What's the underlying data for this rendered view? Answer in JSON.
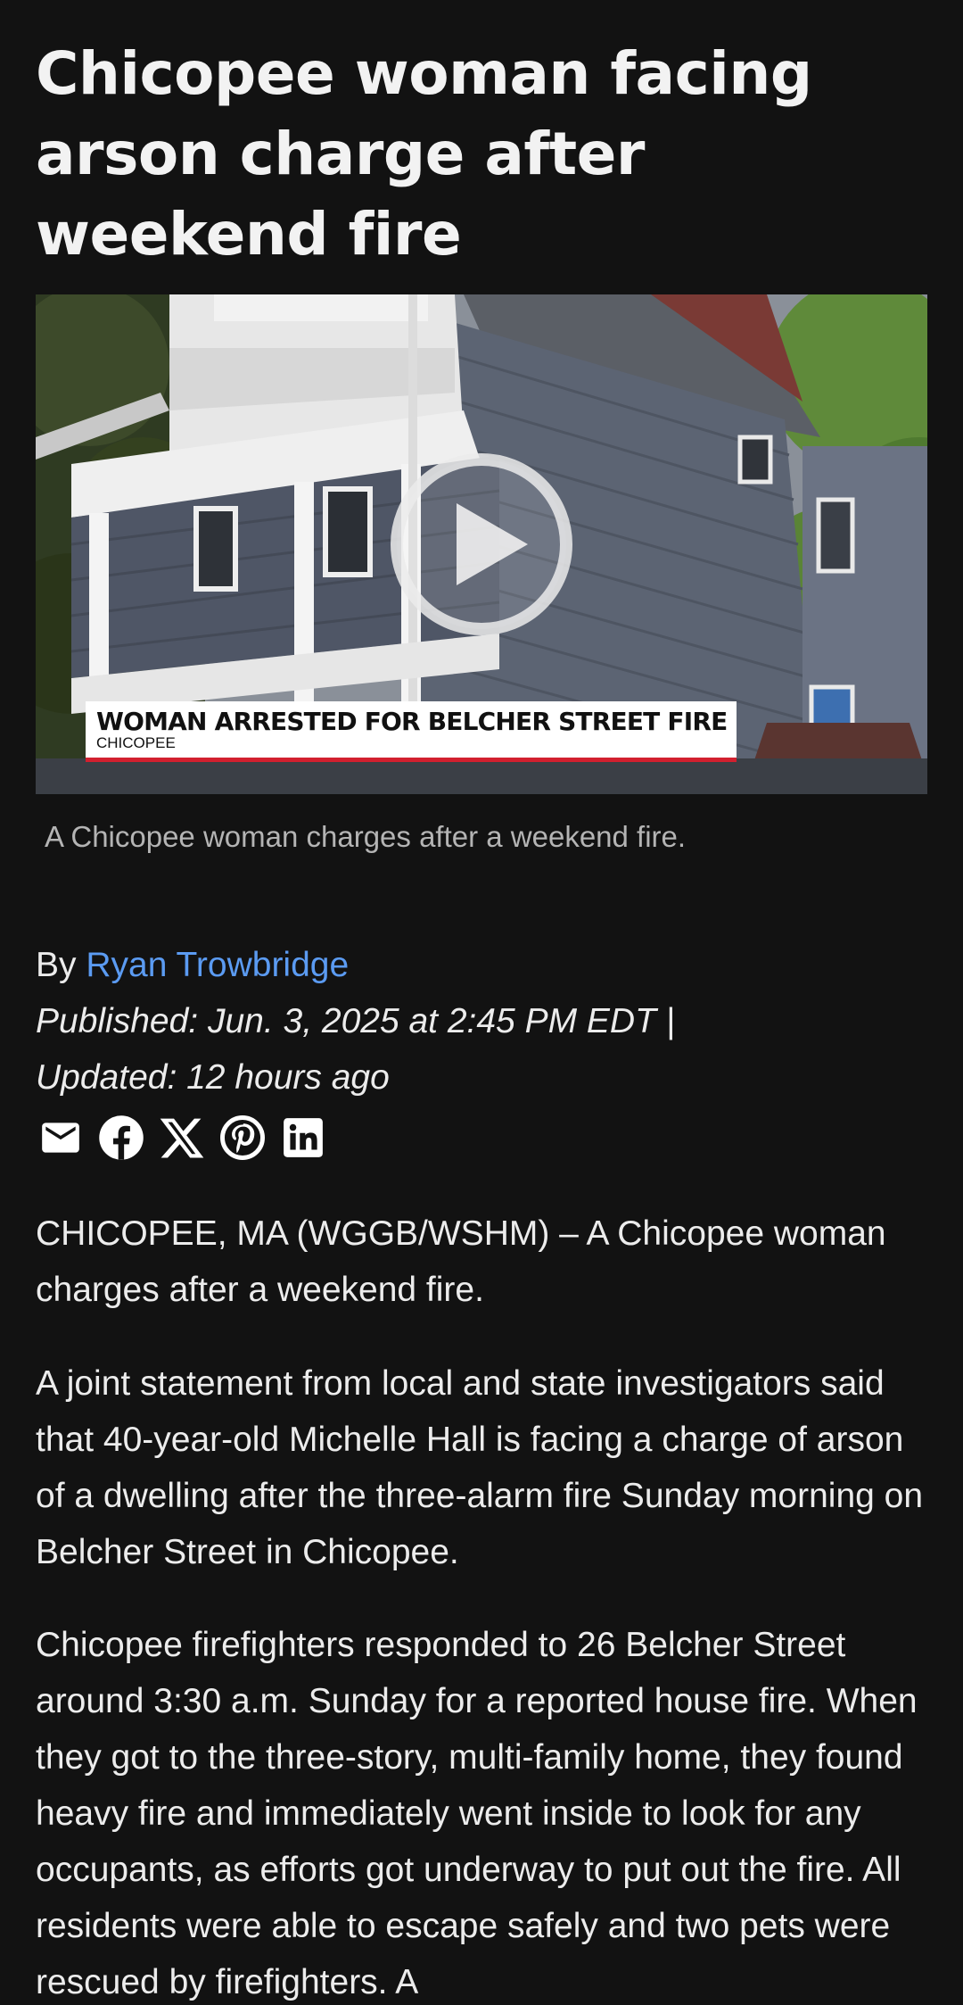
{
  "article": {
    "headline": "Chicopee woman facing arson charge after weekend fire",
    "video": {
      "lower_third_title": "WOMAN ARRESTED FOR BELCHER STREET FIRE",
      "lower_third_location": "CHICOPEE",
      "caption": "A Chicopee woman charges after a weekend fire."
    },
    "byline": {
      "prefix": "By ",
      "author": "Ryan Trowbridge"
    },
    "published": "Published: Jun. 3, 2025 at 2:45 PM EDT  |",
    "updated": "Updated: 12 hours ago",
    "share_icons": [
      "email-icon",
      "facebook-icon",
      "x-icon",
      "pinterest-icon",
      "linkedin-icon"
    ],
    "paragraphs": [
      "CHICOPEE, MA (WGGB/WSHM) – A Chicopee woman charges after a weekend fire.",
      "A joint statement from local and state investigators said that 40-year-old Michelle Hall is facing a charge of arson of a dwelling after the three-alarm fire Sunday morning on Belcher Street in Chicopee.",
      "Chicopee firefighters responded to 26 Belcher Street around 3:30 a.m. Sunday for a reported house fire. When they got to the three-story, multi-family home, they found heavy fire and immediately went inside to look for any occupants, as efforts got underway to put out the fire. All residents were able to escape safely and two pets were rescued by firefighters. A"
    ]
  },
  "colors": {
    "background": "#121212",
    "text": "#ececec",
    "link": "#5b9bf2",
    "caption": "#b4b4b4",
    "lower_third_accent": "#d2202f"
  }
}
